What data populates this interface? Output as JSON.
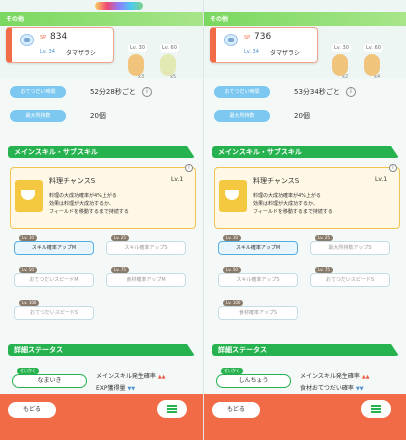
{
  "panels": [
    {
      "header": {
        "label": "その他"
      },
      "monster": {
        "sp_tag": "SP",
        "sp": "834",
        "lv": "Lv. 34",
        "name": "タマザラシ"
      },
      "items": [
        {
          "lv": "Lv. 30",
          "count": "x3",
          "color": "#f0c47b"
        },
        {
          "lv": "Lv. 60",
          "count": "x5",
          "color": "#e4e8b4"
        }
      ],
      "help_interval": {
        "label": "おてつだい時間",
        "value": "52分28秒ごと"
      },
      "max_items": {
        "label": "最大所持数",
        "value": "20個"
      },
      "skill_section": "メインスキル・サブスキル",
      "main_skill": {
        "name": "料理チャンスS",
        "lv": "Lv.1",
        "desc": [
          "料理の大成功確率が4%上がる",
          "効果は料理が大成功するか、",
          "フィールドを移動するまで持続する"
        ]
      },
      "subskills": [
        {
          "lv": "Lv. 10",
          "label": "スキル確率アップM",
          "active": true
        },
        {
          "lv": "Lv. 25",
          "label": "スキル確率アップS",
          "active": false
        },
        {
          "lv": "Lv. 50",
          "label": "おてつだいスピードM",
          "active": false
        },
        {
          "lv": "Lv. 75",
          "label": "食材確率アップM",
          "active": false
        },
        {
          "lv": "Lv. 100",
          "label": "おてつだいスピードS",
          "active": false
        }
      ],
      "stats_section": "詳細ステータス",
      "nature": {
        "tag": "せいかく",
        "value": "なまいき"
      },
      "stats": [
        {
          "label": "メインスキル発生確率",
          "arrows": "▲▲",
          "dir": "up"
        },
        {
          "label": "EXP獲得量",
          "arrows": "▼▼",
          "dir": "down"
        }
      ],
      "footer": {
        "back": "もどる",
        "menu_icon": "menu-icon"
      }
    },
    {
      "header": {
        "label": "その他"
      },
      "monster": {
        "sp_tag": "SP",
        "sp": "736",
        "lv": "Lv. 34",
        "name": "タマザラシ"
      },
      "items": [
        {
          "lv": "Lv. 30",
          "count": "x2",
          "color": "#f0c47b"
        },
        {
          "lv": "Lv. 60",
          "count": "x4",
          "color": "#f0c47b"
        }
      ],
      "help_interval": {
        "label": "おてつだい時間",
        "value": "53分34秒ごと"
      },
      "max_items": {
        "label": "最大所持数",
        "value": "20個"
      },
      "skill_section": "メインスキル・サブスキル",
      "main_skill": {
        "name": "料理チャンスS",
        "lv": "Lv.1",
        "desc": [
          "料理の大成功確率が4%上がる",
          "効果は料理が大成功するか、",
          "フィールドを移動するまで持続する"
        ]
      },
      "subskills": [
        {
          "lv": "Lv. 10",
          "label": "スキル確率アップM",
          "active": true
        },
        {
          "lv": "Lv. 25",
          "label": "最大所持数アップS",
          "active": false
        },
        {
          "lv": "Lv. 50",
          "label": "スキル確率アップS",
          "active": false
        },
        {
          "lv": "Lv. 75",
          "label": "おてつだいスピードS",
          "active": false
        },
        {
          "lv": "Lv. 100",
          "label": "食材確率アップS",
          "active": false
        }
      ],
      "stats_section": "詳細ステータス",
      "nature": {
        "tag": "せいかく",
        "value": "しんちょう"
      },
      "stats": [
        {
          "label": "メインスキル発生確率",
          "arrows": "▲▲",
          "dir": "up"
        },
        {
          "label": "食材おてつだい確率",
          "arrows": "▼▼",
          "dir": "down"
        }
      ],
      "footer": {
        "back": "もどる",
        "menu_icon": "menu-icon"
      }
    }
  ]
}
